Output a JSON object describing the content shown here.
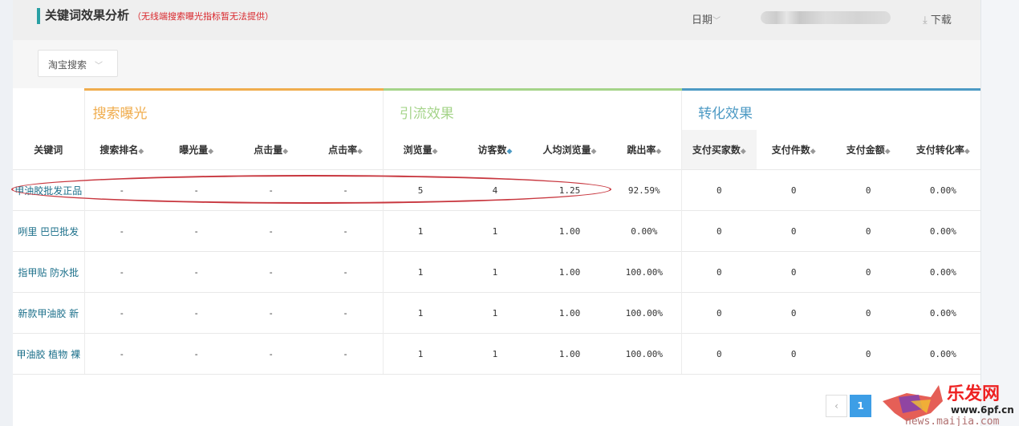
{
  "header": {
    "title": "关键词效果分析",
    "note": "（无线端搜索曝光指标暂无法提供）",
    "date_label": "日期",
    "download_label": "下载"
  },
  "filter": {
    "source_selected": "淘宝搜索"
  },
  "groups": [
    "搜索曝光",
    "引流效果",
    "转化效果"
  ],
  "columns": [
    "关键词",
    "搜索排名",
    "曝光量",
    "点击量",
    "点击率",
    "浏览量",
    "访客数",
    "人均浏览量",
    "跳出率",
    "支付买家数",
    "支付件数",
    "支付金额",
    "支付转化率"
  ],
  "rows": [
    [
      "甲油胶批发正品",
      "-",
      "-",
      "-",
      "-",
      "5",
      "4",
      "1.25",
      "92.59%",
      "0",
      "0",
      "0",
      "0.00%"
    ],
    [
      "咧里 巴巴批发",
      "-",
      "-",
      "-",
      "-",
      "1",
      "1",
      "1.00",
      "0.00%",
      "0",
      "0",
      "0",
      "0.00%"
    ],
    [
      "指甲贴 防水批",
      "-",
      "-",
      "-",
      "-",
      "1",
      "1",
      "1.00",
      "100.00%",
      "0",
      "0",
      "0",
      "0.00%"
    ],
    [
      "新款甲油胶 新",
      "-",
      "-",
      "-",
      "-",
      "1",
      "1",
      "1.00",
      "100.00%",
      "0",
      "0",
      "0",
      "0.00%"
    ],
    [
      "甲油胶 植物 裸",
      "-",
      "-",
      "-",
      "-",
      "1",
      "1",
      "1.00",
      "100.00%",
      "0",
      "0",
      "0",
      "0.00%"
    ]
  ],
  "pagination": {
    "prev": "‹",
    "current": "1"
  },
  "watermark": {
    "brand": "乐发网",
    "url1": "www.6pf.cn",
    "url2": "news.maijia.com"
  },
  "colors": {
    "exposure": "#f0ad4e",
    "traffic": "#a5d48a",
    "conversion": "#4d9ac4",
    "highlight": "#c8373f"
  }
}
